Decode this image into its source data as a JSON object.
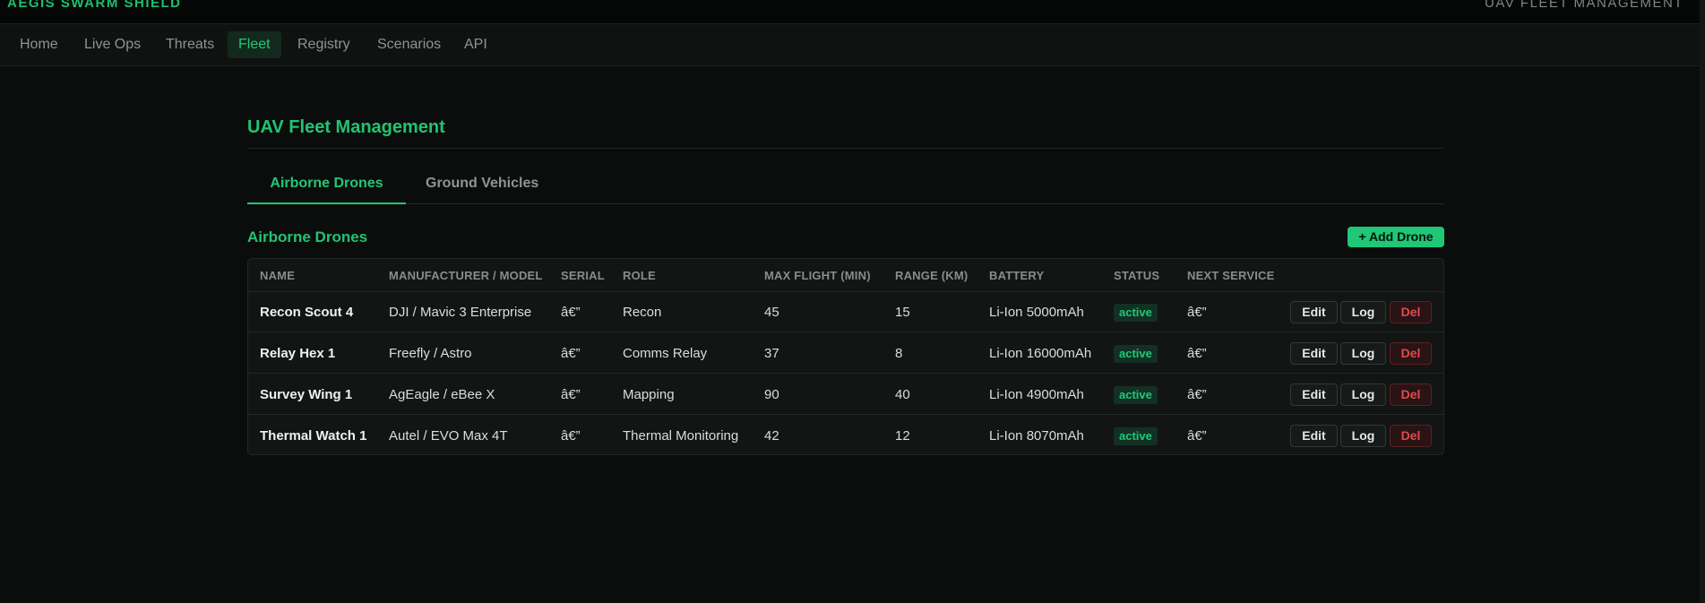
{
  "topbar": {
    "brand": "AEGIS SWARM SHIELD",
    "right_text": "UAV FLEET MANAGEMENT"
  },
  "nav": {
    "items": [
      {
        "label": "Home",
        "active": false
      },
      {
        "label": "Live Ops",
        "active": false
      },
      {
        "label": "Threats",
        "active": false
      },
      {
        "label": "Fleet",
        "active": true
      },
      {
        "label": "Registry",
        "active": false
      },
      {
        "label": "Scenarios",
        "active": false
      },
      {
        "label": "API",
        "active": false
      }
    ]
  },
  "page": {
    "title": "UAV Fleet Management"
  },
  "tabs": [
    {
      "label": "Airborne Drones",
      "active": true
    },
    {
      "label": "Ground Vehicles",
      "active": false
    }
  ],
  "section": {
    "title": "Airborne Drones",
    "add_button": "+ Add Drone"
  },
  "table": {
    "columns": [
      "Name",
      "Manufacturer / Model",
      "Serial",
      "Role",
      "Max Flight (min)",
      "Range (km)",
      "Battery",
      "Status",
      "Next Service"
    ],
    "rows": [
      {
        "name": "Recon Scout 4",
        "model": "DJI / Mavic 3 Enterprise",
        "serial": "â€”",
        "role": "Recon",
        "max_flight": "45",
        "range": "15",
        "battery": "Li-Ion 5000mAh",
        "status": "active",
        "next_service": "â€”"
      },
      {
        "name": "Relay Hex 1",
        "model": "Freefly / Astro",
        "serial": "â€”",
        "role": "Comms Relay",
        "max_flight": "37",
        "range": "8",
        "battery": "Li-Ion 16000mAh",
        "status": "active",
        "next_service": "â€”"
      },
      {
        "name": "Survey Wing 1",
        "model": "AgEagle / eBee X",
        "serial": "â€”",
        "role": "Mapping",
        "max_flight": "90",
        "range": "40",
        "battery": "Li-Ion 4900mAh",
        "status": "active",
        "next_service": "â€”"
      },
      {
        "name": "Thermal Watch 1",
        "model": "Autel / EVO Max 4T",
        "serial": "â€”",
        "role": "Thermal Monitoring",
        "max_flight": "42",
        "range": "12",
        "battery": "Li-Ion 8070mAh",
        "status": "active",
        "next_service": "â€”"
      }
    ],
    "actions": {
      "edit": "Edit",
      "log": "Log",
      "del": "Del"
    }
  },
  "colors": {
    "accent": "#22c777",
    "background": "#0b0d0c",
    "danger": "#e04a4f"
  }
}
